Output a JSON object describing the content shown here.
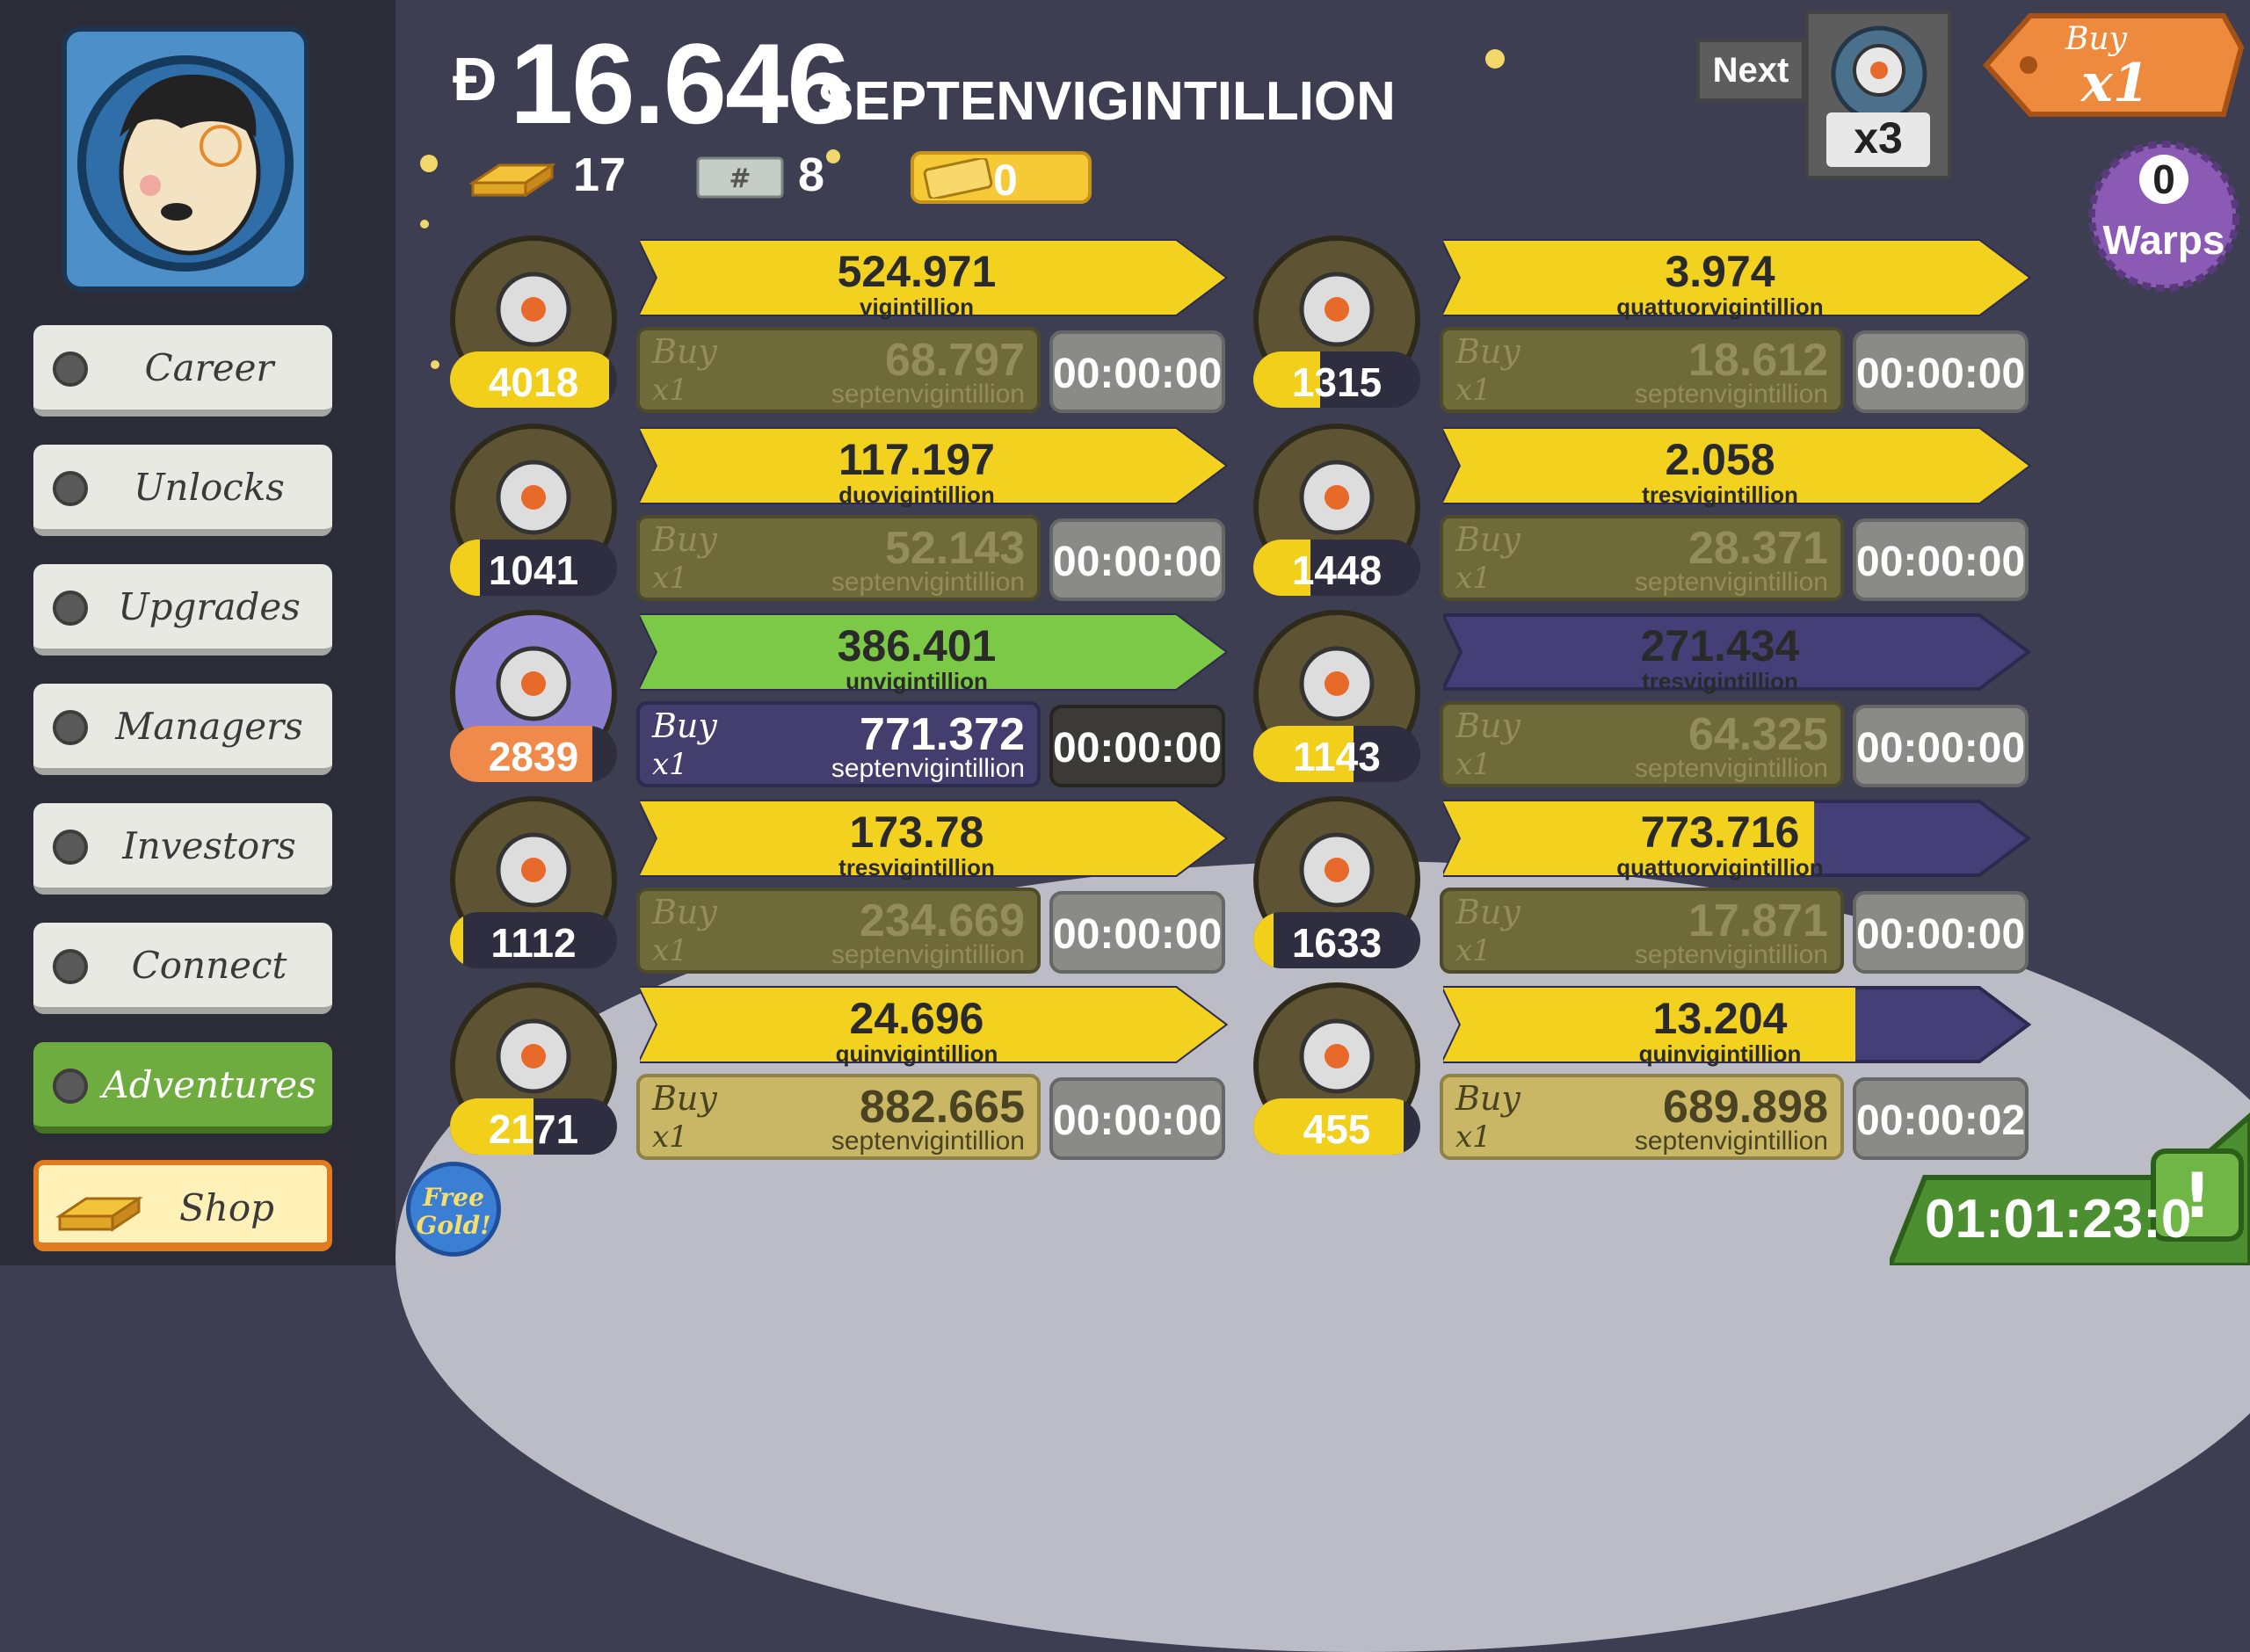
{
  "currency": {
    "amount": "16.646",
    "unit": "SEPTENVIGINTILLION",
    "symbol": "Ð"
  },
  "stats": {
    "gold": "17",
    "megabucks": "8",
    "tickets": "0"
  },
  "next": {
    "label": "Next",
    "multiplier": "x3"
  },
  "buy_mode": {
    "label": "Buy",
    "value": "x1"
  },
  "warps": {
    "count": "0",
    "label": "Warps"
  },
  "menu": {
    "career": "Career",
    "unlocks": "Unlocks",
    "upgrades": "Upgrades",
    "managers": "Managers",
    "investors": "Investors",
    "connect": "Connect",
    "adventures": "Adventures",
    "shop": "Shop"
  },
  "free_gold": {
    "line1": "Free",
    "line2": "Gold!"
  },
  "tv_timer": "01:01:23:0",
  "businesses": [
    {
      "icon": "boots-icon",
      "count": "4018",
      "count_fill": 0.95,
      "revenue": "524.971",
      "revenue_unit": "vigintillion",
      "progress": 1.0,
      "buy_label": "Buy",
      "buy_qty": "x1",
      "cost": "68.797",
      "cost_unit": "septenvigintillion",
      "timer": "00:00:00",
      "state": "locked"
    },
    {
      "icon": "barn-icon",
      "count": "1315",
      "count_fill": 0.4,
      "revenue": "3.974",
      "revenue_unit": "quattuorvigintillion",
      "progress": 1.0,
      "buy_label": "Buy",
      "buy_qty": "x1",
      "cost": "18.612",
      "cost_unit": "septenvigintillion",
      "timer": "00:00:00",
      "state": "locked"
    },
    {
      "icon": "phone-booth-icon",
      "count": "1041",
      "count_fill": 0.18,
      "revenue": "117.197",
      "revenue_unit": "duovigintillion",
      "progress": 1.0,
      "buy_label": "Buy",
      "buy_qty": "x1",
      "cost": "52.143",
      "cost_unit": "septenvigintillion",
      "timer": "00:00:00",
      "state": "locked"
    },
    {
      "icon": "cheese-cart-icon",
      "count": "1448",
      "count_fill": 0.34,
      "revenue": "2.058",
      "revenue_unit": "tresvigintillion",
      "progress": 1.0,
      "buy_label": "Buy",
      "buy_qty": "x1",
      "cost": "28.371",
      "cost_unit": "septenvigintillion",
      "timer": "00:00:00",
      "state": "locked"
    },
    {
      "icon": "aliens-icon",
      "count": "2839",
      "count_fill": 0.85,
      "count_color": "orange",
      "revenue": "386.401",
      "revenue_unit": "unvigintillion",
      "progress": 1.0,
      "progress_color": "green",
      "buy_label": "Buy",
      "buy_qty": "x1",
      "cost": "771.372",
      "cost_unit": "septenvigintillion",
      "timer": "00:00:00",
      "state": "affordable"
    },
    {
      "icon": "moon-coaster-icon",
      "count": "1143",
      "count_fill": 0.6,
      "revenue": "271.434",
      "revenue_unit": "tresvigintillion",
      "progress": 0.0,
      "buy_label": "Buy",
      "buy_qty": "x1",
      "cost": "64.325",
      "cost_unit": "septenvigintillion",
      "timer": "00:00:00",
      "state": "locked"
    },
    {
      "icon": "rocket-icon",
      "count": "1112",
      "count_fill": 0.08,
      "revenue": "173.78",
      "revenue_unit": "tresvigintillion",
      "progress": 1.0,
      "buy_label": "Buy",
      "buy_qty": "x1",
      "cost": "234.669",
      "cost_unit": "septenvigintillion",
      "timer": "00:00:00",
      "state": "locked"
    },
    {
      "icon": "werewolf-icon",
      "count": "1633",
      "count_fill": 0.12,
      "revenue": "773.716",
      "revenue_unit": "quattuorvigintillion",
      "progress": 0.63,
      "buy_label": "Buy",
      "buy_qty": "x1",
      "cost": "17.871",
      "cost_unit": "septenvigintillion",
      "timer": "00:00:00",
      "state": "locked"
    },
    {
      "icon": "cocktail-icon",
      "count": "2171",
      "count_fill": 0.5,
      "revenue": "24.696",
      "revenue_unit": "quinvigintillion",
      "progress": 1.0,
      "buy_label": "Buy",
      "buy_qty": "x1",
      "cost": "882.665",
      "cost_unit": "septenvigintillion",
      "timer": "00:00:00",
      "state": "gold"
    },
    {
      "icon": "ray-gun-icon",
      "count": "455",
      "count_fill": 0.9,
      "revenue": "13.204",
      "revenue_unit": "quinvigintillion",
      "progress": 0.7,
      "buy_label": "Buy",
      "buy_qty": "x1",
      "cost": "689.898",
      "cost_unit": "septenvigintillion",
      "timer": "00:00:02",
      "state": "gold"
    }
  ],
  "colors": {
    "bar_yellow": "#f2d21e",
    "bar_green": "#7cc847",
    "bar_purple": "#453f78",
    "sidebar": "#2b2c38"
  }
}
